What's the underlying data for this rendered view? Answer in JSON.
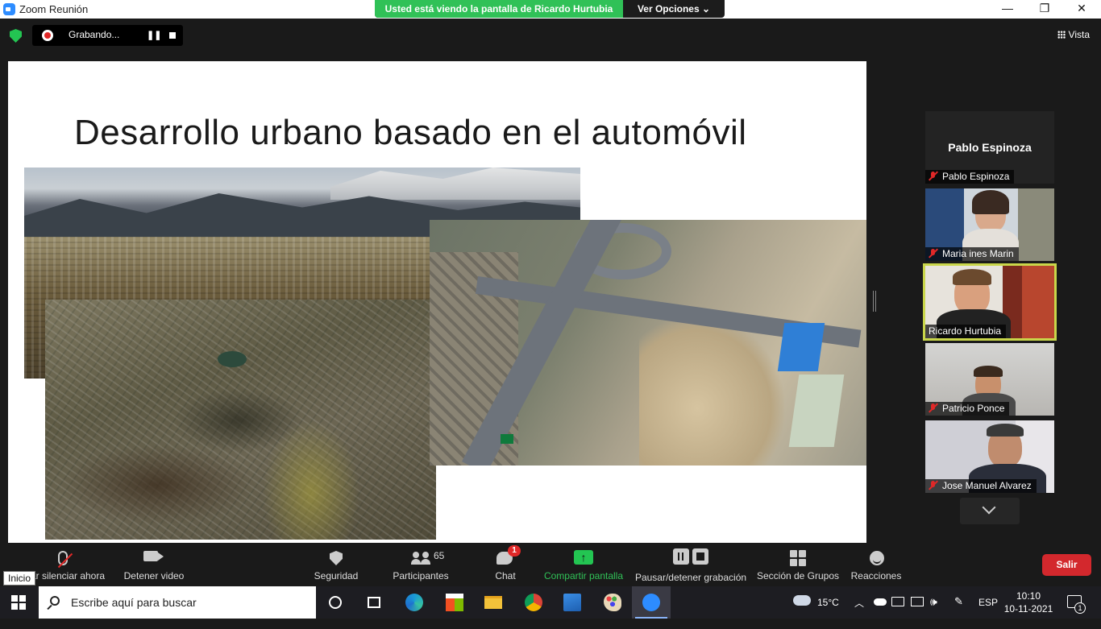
{
  "window": {
    "title": "Zoom Reunión"
  },
  "share_banner": {
    "text": "Usted está viendo la pantalla de Ricardo Hurtubia",
    "options_label": "Ver Opciones ⌄"
  },
  "recording": {
    "label": "Grabando..."
  },
  "view": {
    "label": "Vista"
  },
  "slide": {
    "title": "Desarrollo urbano basado en el automóvil"
  },
  "participants_panel": {
    "tiles": [
      {
        "name": "Pablo Espinoza",
        "display_name": "Pablo Espinoza",
        "muted": true,
        "video": false
      },
      {
        "name": "Maria ines Marin",
        "muted": true,
        "video": true
      },
      {
        "name": "Ricardo Hurtubia",
        "muted": false,
        "video": true,
        "active_speaker": true
      },
      {
        "name": "Patricio Ponce",
        "muted": true,
        "video": true
      },
      {
        "name": "Jose Manuel Alvarez",
        "muted": true,
        "video": true
      }
    ]
  },
  "toolbar": {
    "mute_label": "ar silenciar ahora",
    "video_label": "Detener video",
    "security_label": "Seguridad",
    "participants_label": "Participantes",
    "participants_count": "65",
    "chat_label": "Chat",
    "chat_badge": "1",
    "share_label": "Compartir pantalla",
    "record_label": "Pausar/detener grabación",
    "breakout_label": "Sección de Grupos",
    "reactions_label": "Reacciones",
    "leave_label": "Salir",
    "tooltip": "Inicio"
  },
  "taskbar": {
    "search_placeholder": "Escribe aquí para buscar",
    "weather": "15°C",
    "language": "ESP",
    "time": "10:10",
    "date": "10-11-2021",
    "notifications": "1"
  },
  "colors": {
    "share_green": "#30c157",
    "leave_red": "#d3282d",
    "active_border": "#c9d64a",
    "mute_red": "#e02828"
  }
}
